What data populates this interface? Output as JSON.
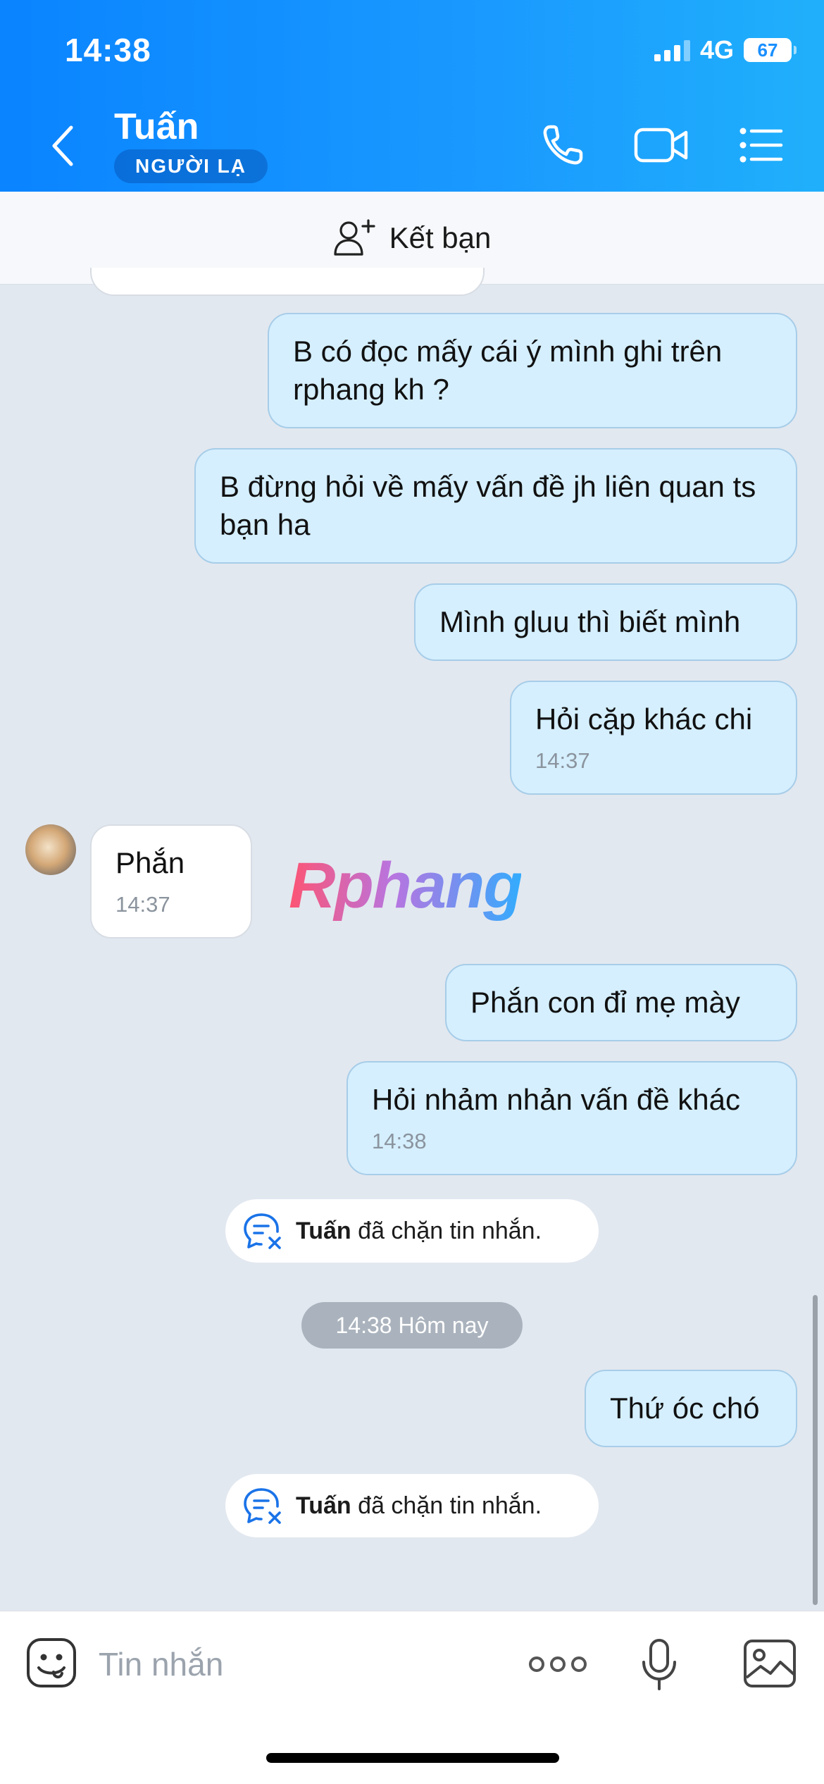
{
  "status_bar": {
    "time": "14:38",
    "network": "4G",
    "battery": "67"
  },
  "header": {
    "contact_name": "Tuấn",
    "badge": "NGƯỜI LẠ",
    "icons": [
      "back-icon",
      "phone-icon",
      "video-camera-icon",
      "menu-list-icon"
    ]
  },
  "add_friend": {
    "label": "Kết bạn"
  },
  "messages": [
    {
      "direction": "out",
      "text": "B có đọc mấy cái ý mình ghi trên rphang kh ?"
    },
    {
      "direction": "out",
      "text": "B đừng hỏi về mấy vấn đề jh liên quan ts bạn ha"
    },
    {
      "direction": "out",
      "text": "Mình gluu thì biết mình"
    },
    {
      "direction": "out",
      "text": "Hỏi cặp khác chi",
      "time": "14:37"
    },
    {
      "direction": "in",
      "text": "Phắn",
      "time": "14:37"
    },
    {
      "direction": "out",
      "text": "Phắn con đỉ mẹ mày"
    },
    {
      "direction": "out",
      "text": "Hỏi nhảm nhản vấn đề khác",
      "time": "14:38"
    },
    {
      "direction": "out",
      "text": "Thứ óc chó"
    }
  ],
  "notices": [
    {
      "name": "Tuấn",
      "text": "đã chặn tin nhắn."
    },
    {
      "name": "Tuấn",
      "text": "đã chặn tin nhắn."
    }
  ],
  "date_separator": "14:38 Hôm nay",
  "watermark": "Rphang",
  "input_bar": {
    "placeholder": "Tin nhắn",
    "value": ""
  },
  "colors": {
    "header_start": "#0a84ff",
    "header_end": "#20b0fb",
    "outgoing_bubble": "#d5efff",
    "incoming_bubble": "#ffffff",
    "chat_background": "#e2e8f0"
  }
}
